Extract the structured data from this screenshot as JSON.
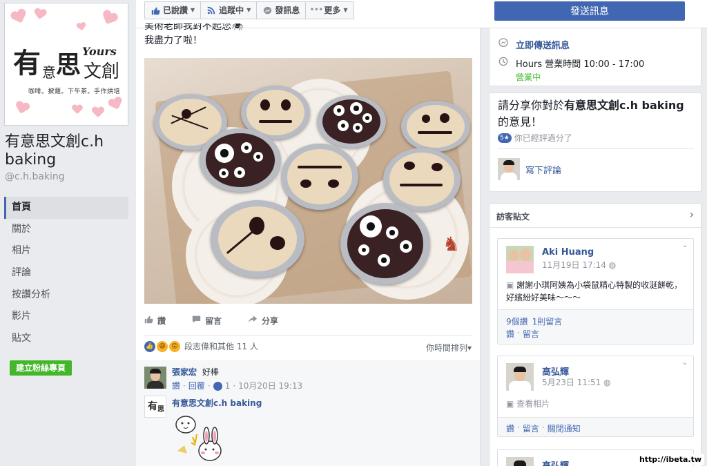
{
  "page": {
    "name": "有意思文創c.h baking",
    "handle": "@c.h.baking",
    "logo_main": "有",
    "logo_yi": "意",
    "logo_si": "思",
    "logo_wen": "文創",
    "logo_yours": "Yours",
    "logo_tagline": "咖啡。披薩。下午茶。手作烘培",
    "create_fan_page": "建立粉絲專頁"
  },
  "nav": {
    "items": [
      {
        "label": "首頁",
        "active": true
      },
      {
        "label": "關於"
      },
      {
        "label": "相片"
      },
      {
        "label": "評論"
      },
      {
        "label": "按讚分析"
      },
      {
        "label": "影片"
      },
      {
        "label": "貼文"
      }
    ]
  },
  "toolbar": {
    "liked": "已說讚",
    "following": "追蹤中",
    "message": "發訊息",
    "more": "更多",
    "send_message": "發送訊息"
  },
  "post": {
    "text_line1": "美術老師我對不起您🕷",
    "text_line2": "我盡力了啦！",
    "like": "讚",
    "comment": "留言",
    "share": "分享",
    "reaction_summary": "段志偉和其他 11 人",
    "sort": "你時間排列▾"
  },
  "comments": [
    {
      "name": "張家宏",
      "text": "好棒",
      "like": "讚",
      "reply": "回覆",
      "likes": "1",
      "time": "10月20日 19:13"
    },
    {
      "name": "有意思文創c.h baking"
    }
  ],
  "sidebar": {
    "send_now": "立即傳送訊息",
    "hours_label": "Hours",
    "hours_text": "營業時間 10:00 - 17:00",
    "open_now": "營業中",
    "review_prompt_a": "請分享你對於",
    "review_prompt_b": "有意思文創c.h baking",
    "review_prompt_c": "的意見！",
    "rating_badge": "5★",
    "rated_text": "你已經評過分了",
    "write_review": "寫下評論",
    "visitor_title": "訪客貼文"
  },
  "visitor_posts": [
    {
      "name": "Aki Huang",
      "time": "11月19日 17:14",
      "text": "謝謝小琪阿姨為小袋鼠精心特製的收涎餅乾，好繽紛好美味～～～",
      "stat_likes": "9個讚",
      "stat_comments": "1則留言",
      "like": "讚",
      "comment": "留言"
    },
    {
      "name": "高弘輝",
      "time": "5月23日 11:51",
      "text": "查看相片",
      "like": "讚",
      "comment": "留言",
      "notify_off": "關閉通知"
    },
    {
      "name": "高弘輝"
    }
  ],
  "watermark": "http://ibeta.tw",
  "colors": {
    "accent": "#4267b2",
    "green": "#42b72a",
    "link": "#365899",
    "background": "#e9ebee"
  }
}
